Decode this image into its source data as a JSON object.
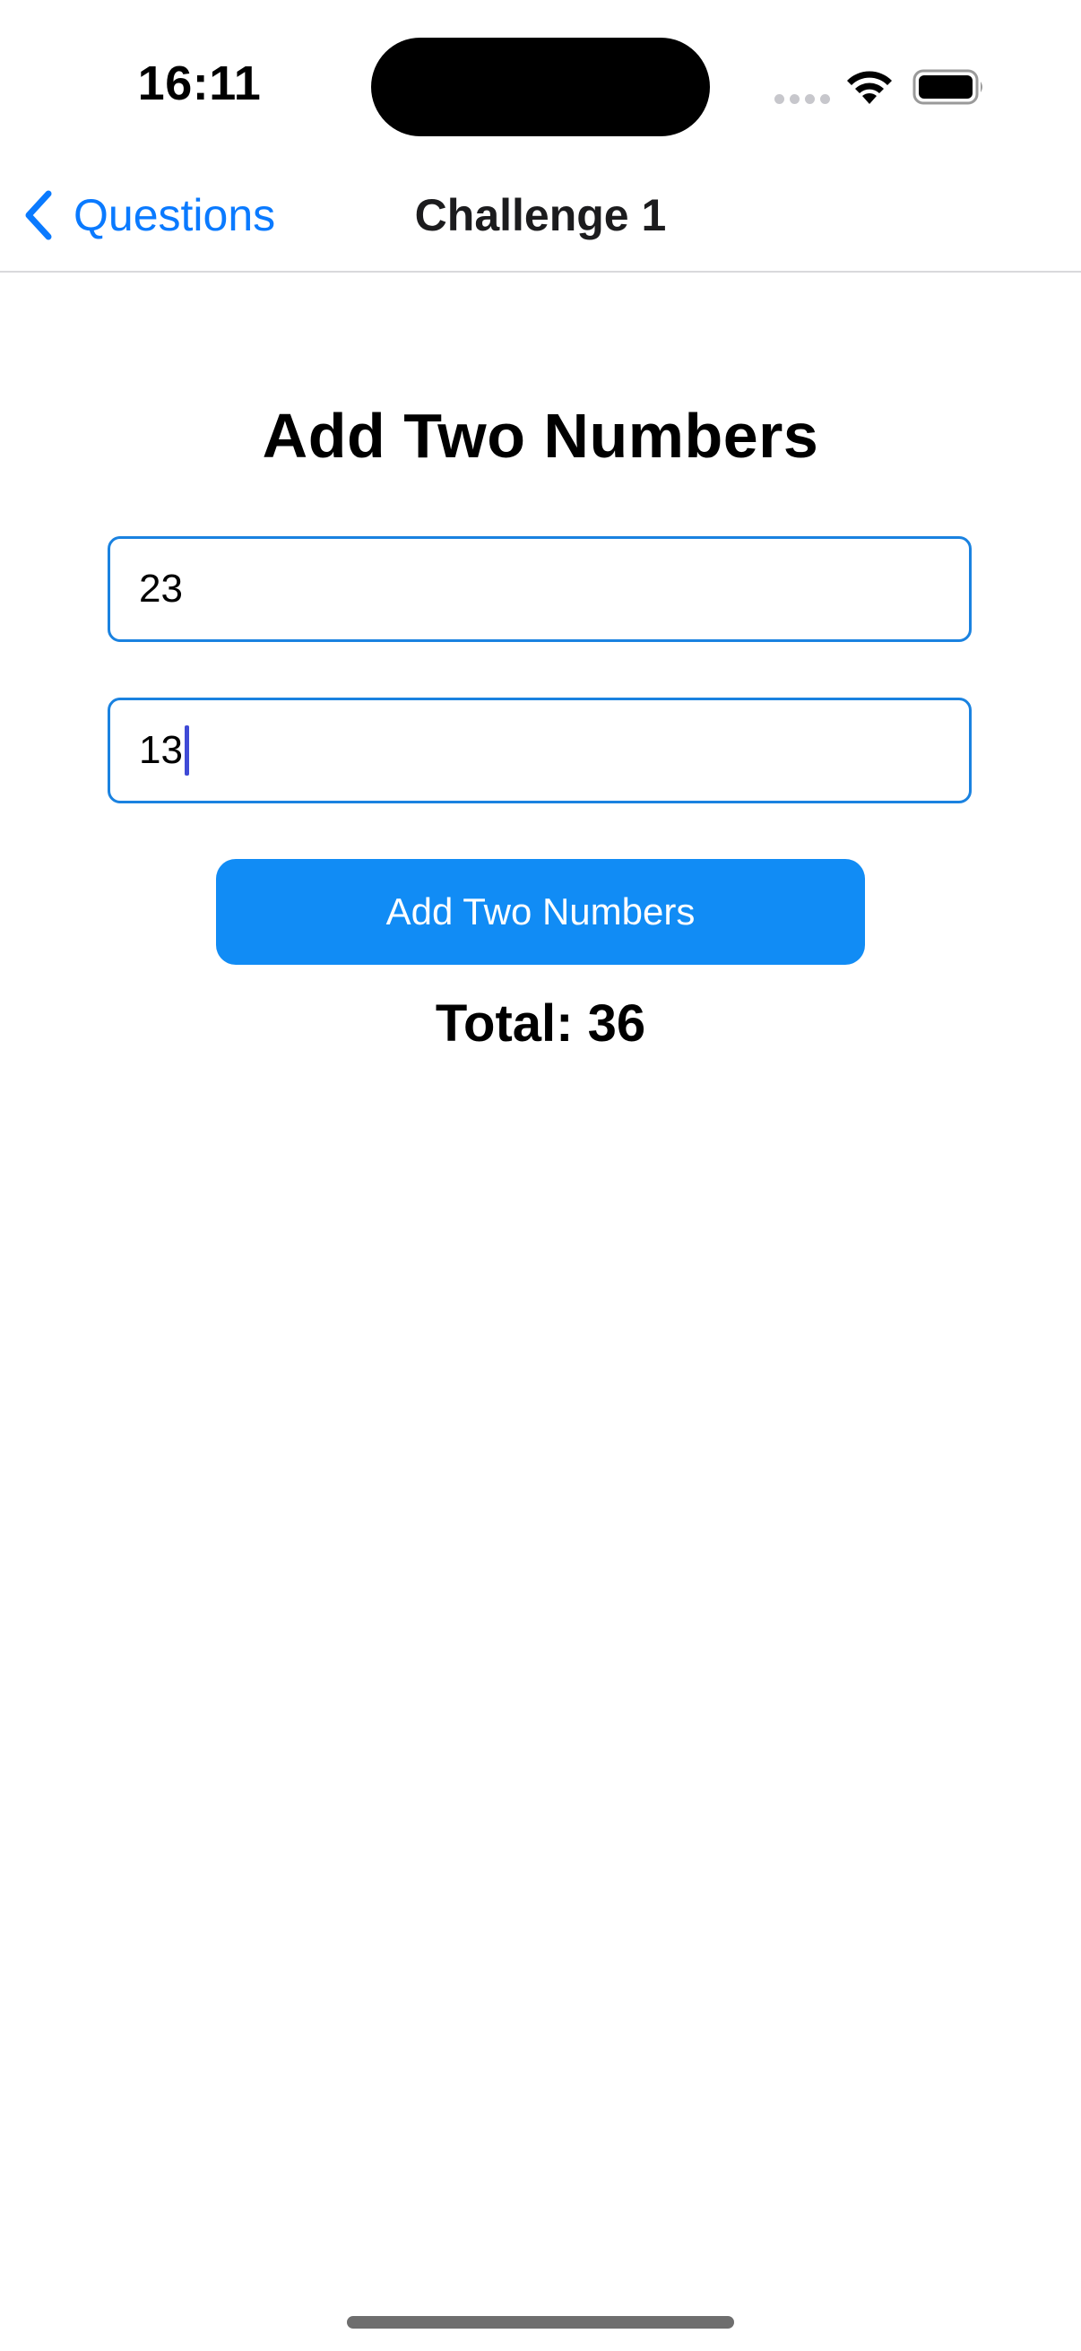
{
  "status_bar": {
    "time": "16:11"
  },
  "nav": {
    "back_label": "Questions",
    "title": "Challenge 1"
  },
  "main": {
    "heading": "Add Two Numbers",
    "field_1_value": "23",
    "field_2_value": "13",
    "button_label": "Add Two Numbers",
    "total_text": "Total: 36"
  },
  "colors": {
    "accent": "#0a7aff",
    "button": "#118cf5",
    "field_border": "#1a82e0",
    "caret": "#3f4ad6"
  },
  "icons": {
    "back": "chevron-left-icon",
    "wifi": "wifi-icon",
    "battery": "battery-icon",
    "signal": "cellular-signal-icon"
  }
}
